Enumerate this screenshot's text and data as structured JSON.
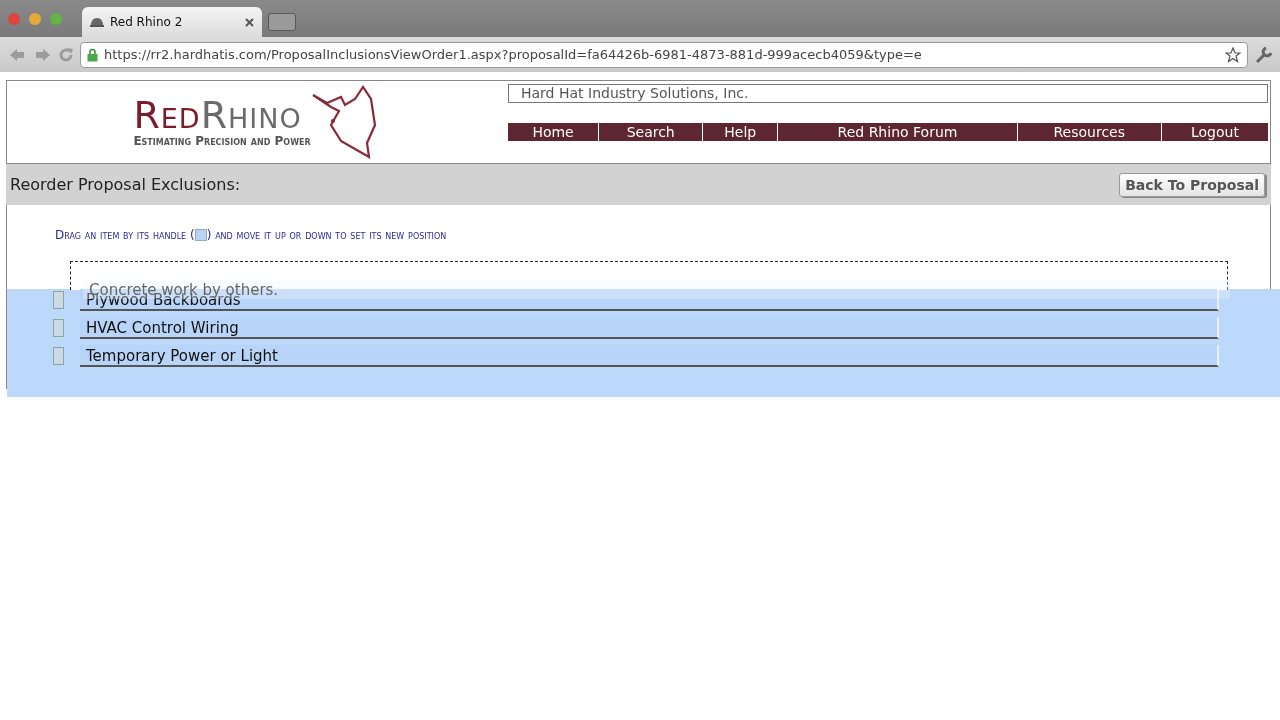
{
  "browser": {
    "tab": {
      "title": "Red Rhino 2"
    },
    "address": "https://rr2.hardhatis.com/ProposalInclusionsViewOrder1.aspx?proposalId=fa64426b-6981-4873-881d-999acecb4059&type=e"
  },
  "header": {
    "logo": {
      "brand_first": "Red",
      "brand_second": "Rhino",
      "tagline": "Estimating Precision and Power"
    },
    "company": "Hard Hat Industry Solutions, Inc.",
    "nav": [
      "Home",
      "Search",
      "Help",
      "Red Rhino Forum",
      "Resources",
      "Logout"
    ]
  },
  "title_bar": {
    "title": "Reorder Proposal Exclusions:",
    "button": "Back To Proposal"
  },
  "instructions": {
    "before_handle": "Drag an item by its handle (",
    "after_handle": ") and move it up or down to set its new position"
  },
  "dragged_item": {
    "label": "Concrete work by others."
  },
  "items": [
    {
      "label": "Plywood Backboards"
    },
    {
      "label": "HVAC Control Wiring"
    },
    {
      "label": "Temporary Power or Light"
    }
  ]
}
